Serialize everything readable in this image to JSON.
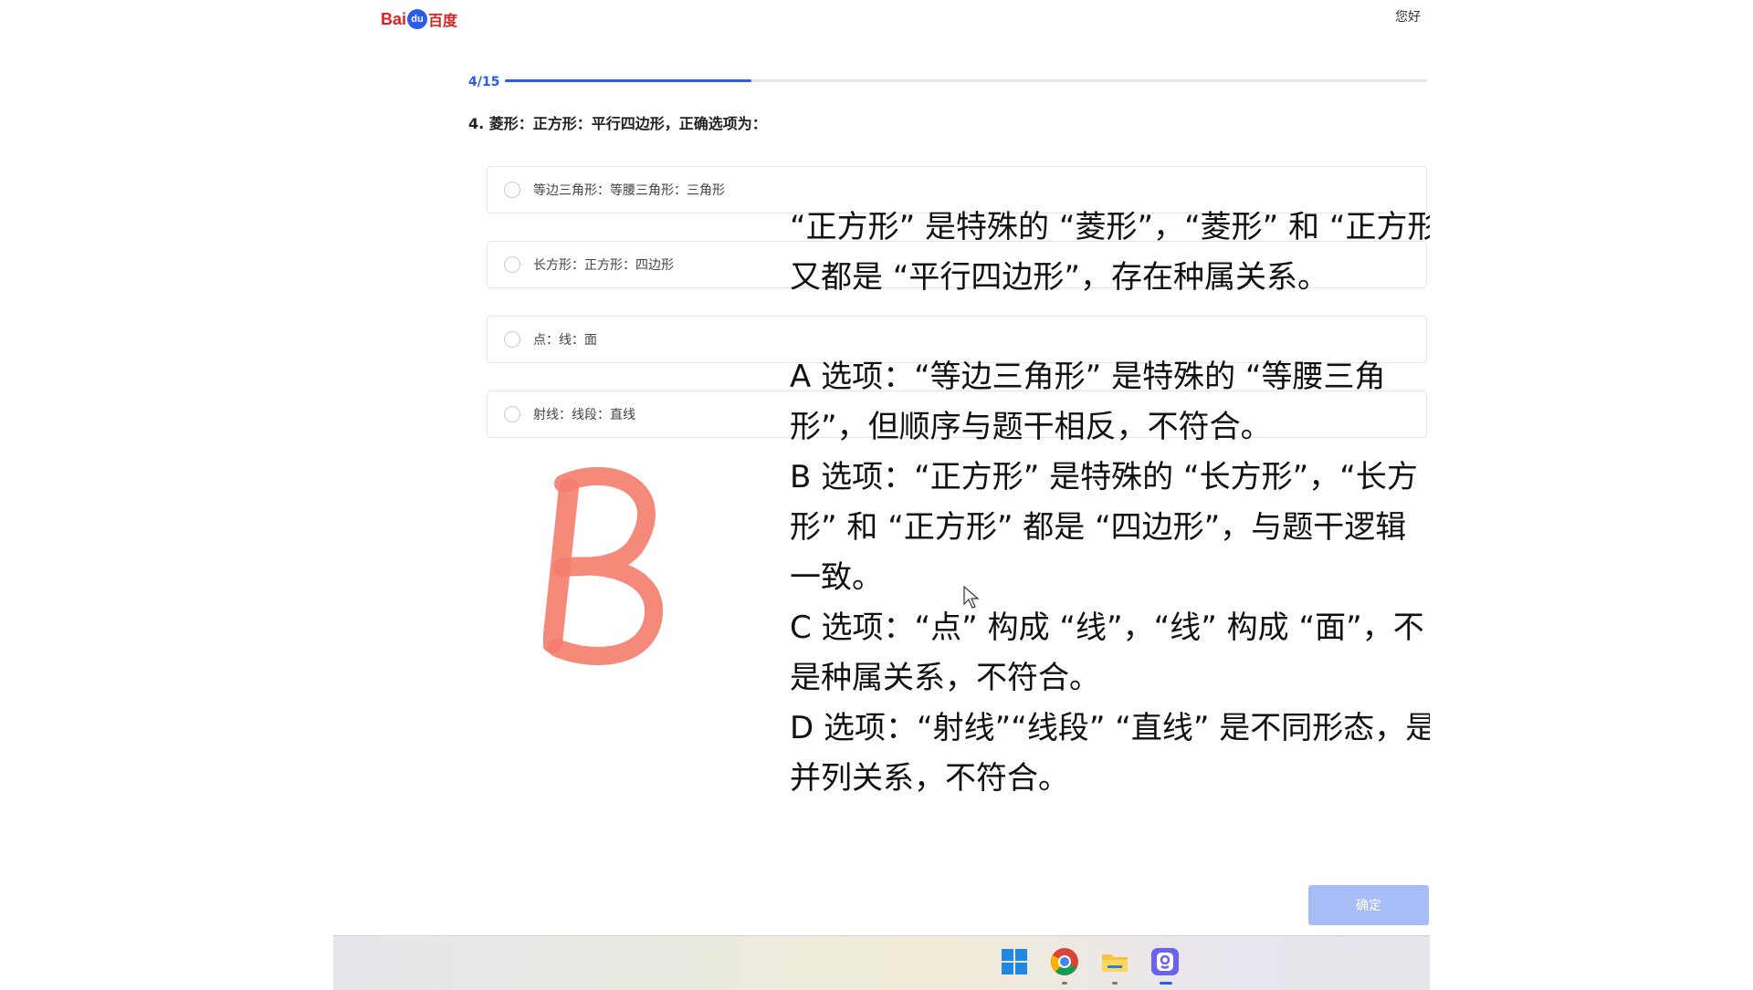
{
  "header": {
    "logo_bai": "Bai",
    "logo_du": "du",
    "logo_cn": "百度",
    "greeting": "您好"
  },
  "progress": {
    "label": "4/15",
    "current": 4,
    "total": 15,
    "fill_fraction": 0.267
  },
  "question": {
    "text": "4. 菱形：正方形：平行四边形，正确选项为："
  },
  "options": [
    {
      "label": "等边三角形：等腰三角形：三角形"
    },
    {
      "label": "长方形：正方形：四边形"
    },
    {
      "label": "点：线：面"
    },
    {
      "label": "射线：线段：直线"
    }
  ],
  "handwritten_answer": "B",
  "explanation": {
    "intro_line1": "“正方形” 是特殊的 “菱形”，“菱形” 和 “正方形”",
    "intro_line2": "又都是 “平行四边形”，存在种属关系。",
    "a_line1": "A 选项：“等边三角形” 是特殊的 “等腰三角",
    "a_line2": "形”，但顺序与题干相反，不符合。",
    "b_line1": "B 选项：“正方形” 是特殊的 “长方形”，“长方",
    "b_line2": "形” 和 “正方形” 都是 “四边形”，与题干逻辑",
    "b_line3": "一致。",
    "c_line1": "C 选项：“点” 构成 “线”，“线” 构成 “面”，不",
    "c_line2": "是种属关系，不符合。",
    "d_line1": "D 选项：“射线”“线段” “直线” 是不同形态，是",
    "d_line2": "并列关系，不符合。"
  },
  "confirm_button": "确定",
  "taskbar": {
    "icons": [
      "windows-start-icon",
      "chrome-icon",
      "file-explorer-icon",
      "app-icon"
    ]
  },
  "colors": {
    "accent": "#2d5ce6",
    "button_disabled": "#a8bdf8",
    "handwriting": "#f47c6c"
  }
}
